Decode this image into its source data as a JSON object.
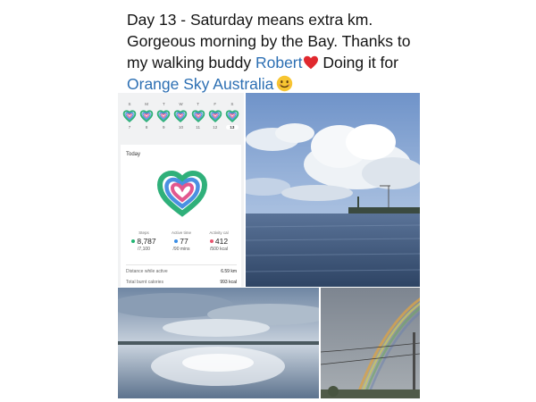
{
  "post": {
    "line1": "Day 13 - Saturday means extra km.",
    "line2": "Gorgeous morning by the Bay. Thanks to",
    "line3_prefix": "my walking buddy ",
    "buddy_name": "Robert",
    "line3_suffix": " Doing it for",
    "charity_link": "Orange Sky Australia",
    "link_color": "#2c6fb3",
    "emojis": [
      "red-heart-emoji",
      "smiling-face-emoji"
    ]
  },
  "fitness": {
    "day_letters": [
      "S",
      "M",
      "T",
      "W",
      "T",
      "F",
      "S"
    ],
    "day_numbers": [
      "7",
      "8",
      "9",
      "10",
      "11",
      "12",
      "13"
    ],
    "selected_day": "13",
    "section_title": "Today",
    "stats": [
      {
        "label": "Steps",
        "value": "8,787",
        "goal": "/7,100",
        "color": "#21b573"
      },
      {
        "label": "Active time",
        "value": "77",
        "goal": "/90 mins",
        "color": "#3a8ee6"
      },
      {
        "label": "Activity cal",
        "value": "412",
        "goal": "/500 kcal",
        "color": "#e8556f"
      }
    ],
    "distance_label": "Distance while active",
    "distance_value": "6.59 km",
    "burnt_label": "Total burnt calories",
    "burnt_value": "993 kcal"
  }
}
